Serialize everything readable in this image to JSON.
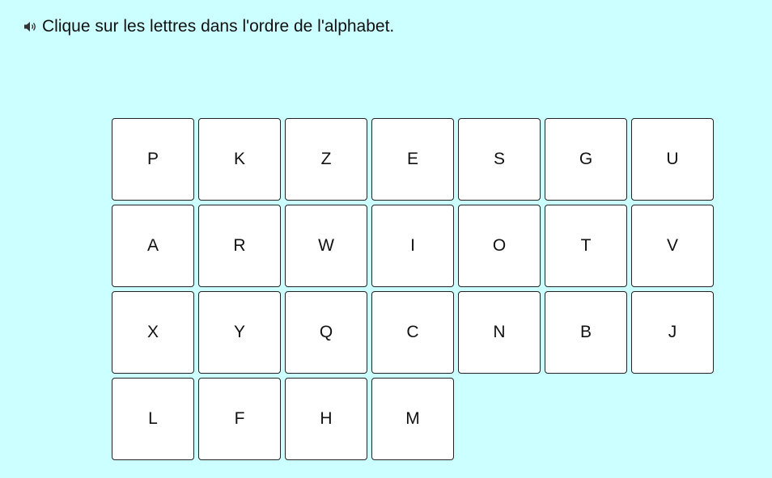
{
  "instruction": {
    "icon": "speaker-icon",
    "text": "Clique sur les lettres dans l'ordre de l'alphabet."
  },
  "letters": [
    "P",
    "K",
    "Z",
    "E",
    "S",
    "G",
    "U",
    "A",
    "R",
    "W",
    "I",
    "O",
    "T",
    "V",
    "X",
    "Y",
    "Q",
    "C",
    "N",
    "B",
    "J",
    "L",
    "F",
    "H",
    "M"
  ],
  "colors": {
    "background": "#ccffff",
    "tile": "#ffffff",
    "tile_border": "#222222"
  }
}
